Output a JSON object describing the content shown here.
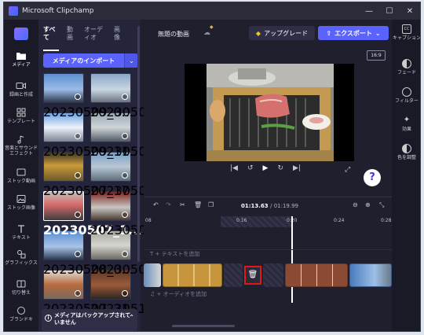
{
  "window": {
    "title": "Microsoft Clipchamp"
  },
  "nav": {
    "items": [
      {
        "label": "メディア",
        "icon": "folder-icon"
      },
      {
        "label": "録画と作成",
        "icon": "camera-icon"
      },
      {
        "label": "テンプレート",
        "icon": "template-icon"
      },
      {
        "label": "音楽とサウンドエフェクト",
        "icon": "music-icon"
      },
      {
        "label": "ストック動画",
        "icon": "film-icon"
      },
      {
        "label": "ストック画像",
        "icon": "image-icon"
      },
      {
        "label": "テキスト",
        "icon": "text-icon"
      },
      {
        "label": "グラフィックス",
        "icon": "shapes-icon"
      },
      {
        "label": "切り替え",
        "icon": "transition-icon"
      },
      {
        "label": "ブランドキ",
        "icon": "brand-icon"
      }
    ]
  },
  "media": {
    "tabs": [
      "すべて",
      "動画",
      "オーディオ",
      "画像"
    ],
    "import_label": "メディアのインポート",
    "thumbnails": [
      "20230509_0...",
      "20230509_12...",
      "20230509_11...",
      "20230507_17...",
      "20230507_17...",
      "20230507_14...",
      "20230507_1...",
      "20230508_15...",
      "20230508_0...",
      "20230508_2...",
      "20230507_21...",
      "20230510_12..."
    ],
    "toast": "メディアはバックアップされていません"
  },
  "header": {
    "project_title": "無題の動画",
    "upgrade_label": "アップグレード",
    "export_label": "エクスポート",
    "aspect_ratio": "16:9"
  },
  "timeline": {
    "current_time": "01:13.63",
    "total_time": "/ 01:19.99",
    "ticks": [
      "08",
      "0:16",
      "0:20",
      "0:24",
      "0:28"
    ],
    "text_track": "T  + テキストを追加",
    "audio_track": "♫  + オーディオを追加"
  },
  "right_panel": {
    "items": [
      "キャプション",
      "フェード",
      "フィルター",
      "効果",
      "色を調整"
    ]
  },
  "colors": {
    "accent": "#5b63ff",
    "highlight": "#e01818"
  }
}
